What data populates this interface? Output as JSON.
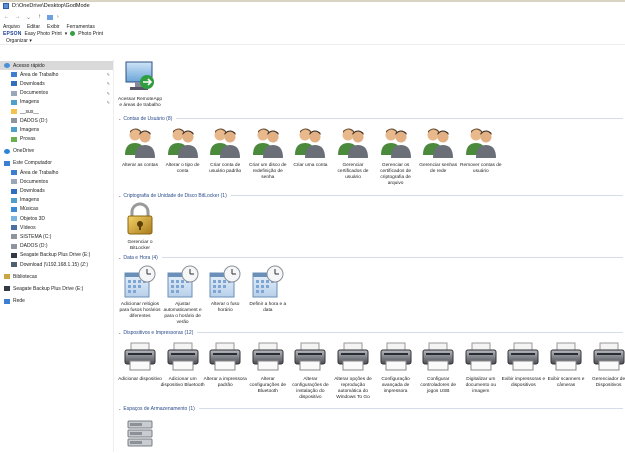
{
  "window": {
    "address_path": "D:\\OneDrive\\Desktop\\GodMode"
  },
  "nav": {
    "back": "←",
    "forward": "→",
    "recent": "⌄",
    "up": "↑",
    "chevron": "›"
  },
  "menu": [
    "Arquivo",
    "Editar",
    "Exibir",
    "Ferramentas"
  ],
  "printbar": {
    "epson_brand": "EPSON",
    "epson_label": "Easy Photo Print",
    "arrow": "▾",
    "photo_print": "Photo Print"
  },
  "toolbar": {
    "organizar": "Organizar ▾"
  },
  "sidebar": [
    {
      "label": "Acesso rápido",
      "icon": "star",
      "selected": true,
      "pinned": false,
      "indent": 1,
      "gap_before": false
    },
    {
      "label": "Área de Trabalho",
      "icon": "desktop",
      "pinned": true,
      "indent": 2,
      "gap_before": false
    },
    {
      "label": "Downloads",
      "icon": "download",
      "pinned": true,
      "indent": 2,
      "gap_before": false
    },
    {
      "label": "Documentos",
      "icon": "documents",
      "pinned": true,
      "indent": 2,
      "gap_before": false
    },
    {
      "label": "Imagens",
      "icon": "pictures",
      "pinned": true,
      "indent": 2,
      "gap_before": false
    },
    {
      "label": "__sus__",
      "icon": "folder",
      "pinned": false,
      "indent": 2,
      "gap_before": false
    },
    {
      "label": "DADOS (D:)",
      "icon": "drive",
      "pinned": false,
      "indent": 2,
      "gap_before": false
    },
    {
      "label": "Imagens",
      "icon": "pictures",
      "pinned": false,
      "indent": 2,
      "gap_before": false
    },
    {
      "label": "Provas",
      "icon": "folder-green",
      "pinned": false,
      "indent": 2,
      "gap_before": false
    },
    {
      "label": "OneDrive",
      "icon": "cloud",
      "pinned": false,
      "indent": 1,
      "gap_before": true
    },
    {
      "label": "Este Computador",
      "icon": "computer",
      "pinned": false,
      "indent": 1,
      "gap_before": true
    },
    {
      "label": "Área de Trabalho",
      "icon": "desktop",
      "pinned": false,
      "indent": 2,
      "gap_before": false
    },
    {
      "label": "Documentos",
      "icon": "documents",
      "pinned": false,
      "indent": 2,
      "gap_before": false
    },
    {
      "label": "Downloads",
      "icon": "download",
      "pinned": false,
      "indent": 2,
      "gap_before": false
    },
    {
      "label": "Imagens",
      "icon": "pictures",
      "pinned": false,
      "indent": 2,
      "gap_before": false
    },
    {
      "label": "Músicas",
      "icon": "music",
      "pinned": false,
      "indent": 2,
      "gap_before": false
    },
    {
      "label": "Objetos 3D",
      "icon": "objects3d",
      "pinned": false,
      "indent": 2,
      "gap_before": false
    },
    {
      "label": "Vídeos",
      "icon": "videos",
      "pinned": false,
      "indent": 2,
      "gap_before": false
    },
    {
      "label": "SISTEMA (C:)",
      "icon": "drive",
      "pinned": false,
      "indent": 2,
      "gap_before": false
    },
    {
      "label": "DADOS (D:)",
      "icon": "drive",
      "pinned": false,
      "indent": 2,
      "gap_before": false
    },
    {
      "label": "Seagate Backup Plus Drive (E:)",
      "icon": "external-drive",
      "pinned": false,
      "indent": 2,
      "gap_before": false
    },
    {
      "label": "Download (\\\\192.168.1.15) (Z:)",
      "icon": "network-drive",
      "pinned": false,
      "indent": 2,
      "gap_before": false
    },
    {
      "label": "Bibliotecas",
      "icon": "libraries",
      "pinned": false,
      "indent": 1,
      "gap_before": true
    },
    {
      "label": "Seagate Backup Plus Drive (E:)",
      "icon": "external-drive",
      "pinned": false,
      "indent": 1,
      "gap_before": true
    },
    {
      "label": "Rede",
      "icon": "network",
      "pinned": false,
      "indent": 1,
      "gap_before": true
    }
  ],
  "groups": [
    {
      "title": "",
      "icon": "remoteapp",
      "items": [
        "Acessar RemoteApp e áreas de trabalho"
      ]
    },
    {
      "title": "Contas de Usuário (8)",
      "icon": "users",
      "items": [
        "Alterar as contas",
        "Alterar o tipo de conta",
        "Criar conta de usuário padrão",
        "Criar um disco de redefinição de senha",
        "Criar uma conta",
        "Gerenciar certificados de usuário",
        "Gerenciar os certificados de criptografia de arquivo",
        "Gerenciar senhas de rede",
        "Remover contas de usuário"
      ]
    },
    {
      "title": "Criptografia de Unidade de Disco BitLocker (1)",
      "icon": "bitlocker",
      "items": [
        "Gerenciar o BitLocker"
      ]
    },
    {
      "title": "Data e Hora (4)",
      "icon": "datetime",
      "items": [
        "Adicionar relógios para fusos horários diferentes",
        "Ajustar automaticament e para o horário de verão",
        "Alterar o fuso horário",
        "Definir a hora e a data"
      ]
    },
    {
      "title": "Dispositivos e Impressoras (12)",
      "icon": "printer",
      "items": [
        "Adicionar dispositivo",
        "Adicionar um dispositivo Bluetooth",
        "Alterar a impressora padrão",
        "Alterar configurações de Bluetooth",
        "Alterar configurações de instalação do dispositivo",
        "Alterar opções de reprodução automática do Windows To Go",
        "Configuração avançada de impressora",
        "Configurar controladores de jogos USB",
        "Digitalizar um documento ou imagem",
        "Exibir impressoras e dispositivos",
        "Exibir scanners e câmeras",
        "Gerenciador de Dispositivos"
      ]
    },
    {
      "title": "Espaços de Armazenamento (1)",
      "icon": "storage",
      "items": [
        ""
      ]
    }
  ],
  "icons": {
    "folder": "#f2c14e",
    "users": "#7a5a3a",
    "accent": "#2a4a8a"
  }
}
